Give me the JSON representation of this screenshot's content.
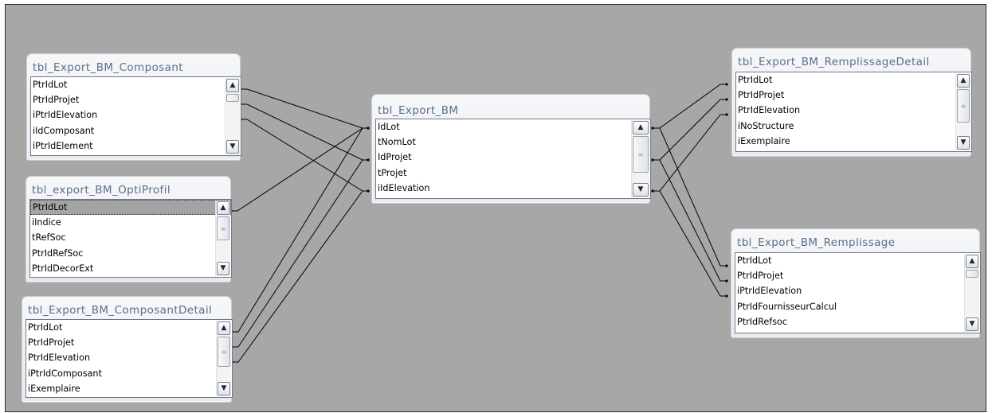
{
  "tables": {
    "composant": {
      "title": "tbl_Export_BM_Composant",
      "fields": [
        "PtrIdLot",
        "PtrIdProjet",
        "iPtrIdElevation",
        "iIdComposant",
        "iPtrIdElement"
      ]
    },
    "optiprofil": {
      "title": "tbl_export_BM_OptiProfil",
      "fields": [
        "PtrIdLot",
        "iIndice",
        "tRefSoc",
        "PtrIdRefSoc",
        "PtrIdDecorExt"
      ]
    },
    "composantdetail": {
      "title": "tbl_Export_BM_ComposantDetail",
      "fields": [
        "PtrIdLot",
        "PtrIdProjet",
        "PtrIdElevation",
        "iPtrIdComposant",
        "iExemplaire"
      ]
    },
    "bm": {
      "title": "tbl_Export_BM",
      "fields": [
        "IdLot",
        "tNomLot",
        "IdProjet",
        "tProjet",
        "iIdElevation"
      ]
    },
    "remplissagedetail": {
      "title": "tbl_Export_BM_RemplissageDetail",
      "fields": [
        "PtrIdLot",
        "PtrIdProjet",
        "PtrIdElevation",
        "iNoStructure",
        "iExemplaire"
      ]
    },
    "remplissage": {
      "title": "tbl_Export_BM_Remplissage",
      "fields": [
        "PtrIdLot",
        "PtrIdProjet",
        "iPtrIdElevation",
        "PtrIdFournisseurCalcul",
        "PtrIdRefsoc"
      ]
    }
  },
  "scrollbar": {
    "up_icon": "chevron-up-icon",
    "down_icon": "chevron-down-icon",
    "thumb_grip_icon": "grip-icon"
  },
  "colors": {
    "canvas": "#a7a7a7",
    "title_text": "#5a6f8a",
    "relationship_line": "#000000"
  }
}
